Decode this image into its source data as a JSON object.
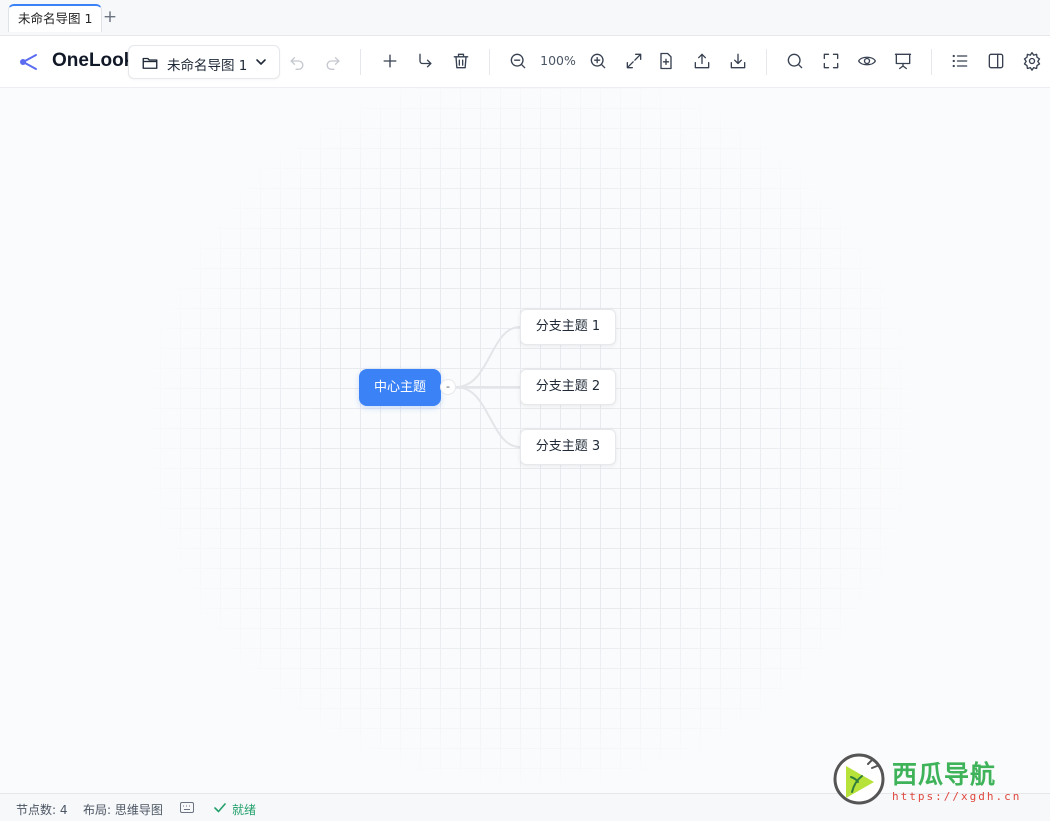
{
  "tabs": [
    {
      "label": "未命名导图 1"
    }
  ],
  "tab_add": "+",
  "toolbar": {
    "brand": "OneLook",
    "file_name": "未命名导图 1",
    "zoom": "100%",
    "icons": [
      "undo-icon",
      "redo-icon",
      "add-node-icon",
      "add-child-icon",
      "delete-icon",
      "zoom-out-icon",
      "zoom-in-icon",
      "fit-view-icon",
      "new-file-icon",
      "export-icon",
      "download-icon",
      "search-icon",
      "fullscreen-icon",
      "preview-icon",
      "present-icon",
      "outline-icon",
      "side-panel-icon",
      "settings-icon"
    ]
  },
  "mindmap": {
    "root": {
      "label": "中心主题",
      "collapse": "-"
    },
    "children": [
      {
        "label": "分支主题 1"
      },
      {
        "label": "分支主题 2"
      },
      {
        "label": "分支主题 3"
      }
    ]
  },
  "status": {
    "node_count": "节点数: 4",
    "layout": "布局: 思维导图",
    "ready": "就绪"
  },
  "watermark": {
    "title": "西瓜导航",
    "url": "https://xgdh.cn"
  },
  "colors": {
    "accent": "#3b82f6",
    "ready": "#22a06b",
    "watermark_green": "#3fb35a",
    "watermark_red": "#e0483e"
  }
}
